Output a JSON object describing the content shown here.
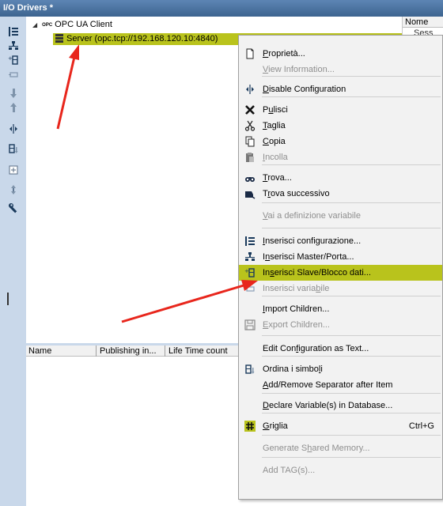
{
  "window": {
    "title": "I/O Drivers *"
  },
  "tree": {
    "root_label": "OPC UA Client",
    "root_badge": "OPC",
    "server_label": "Server (opc.tcp://192.168.120.10:4840)"
  },
  "right_panel": {
    "header": "Nome",
    "cell": "Sess"
  },
  "bottom_panel": {
    "columns": [
      "Name",
      "Publishing in...",
      "Life Time count"
    ]
  },
  "context_menu": {
    "items": [
      {
        "pre": "",
        "u": "P",
        "post": "roprietà...",
        "icon": "property-page-icon"
      },
      {
        "pre": "",
        "u": "V",
        "post": "iew Information...",
        "disabled": true
      },
      {
        "pre": "",
        "u": "D",
        "post": "isable Configuration",
        "icon": "link-broken-icon"
      },
      {
        "pre": "P",
        "u": "u",
        "post": "lisci",
        "icon": "delete-x-icon"
      },
      {
        "pre": "",
        "u": "T",
        "post": "aglia",
        "icon": "scissors-icon"
      },
      {
        "pre": "",
        "u": "C",
        "post": "opia",
        "icon": "copy-icon"
      },
      {
        "pre": "",
        "u": "I",
        "post": "ncolla",
        "icon": "paste-icon",
        "disabled": true
      },
      {
        "pre": "",
        "u": "T",
        "post": "rova...",
        "icon": "binoculars-icon"
      },
      {
        "pre": "T",
        "u": "r",
        "post": "ova successivo",
        "icon": "find-next-icon"
      },
      {
        "pre": "",
        "u": "V",
        "post": "ai a definizione variabile",
        "disabled": true
      },
      {
        "pre": "",
        "u": "I",
        "post": "nserisci configurazione...",
        "icon": "insert-config-icon"
      },
      {
        "pre": "I",
        "u": "n",
        "post": "serisci Master/Porta...",
        "icon": "insert-master-icon"
      },
      {
        "pre": "In",
        "u": "s",
        "post": "erisci Slave/Blocco dati...",
        "icon": "insert-slave-icon",
        "highlighted": true
      },
      {
        "pre": "Inserisci varia",
        "u": "b",
        "post": "ile",
        "icon": "insert-variable-icon",
        "disabled": true
      },
      {
        "pre": "",
        "u": "I",
        "post": "mport Children...",
        "icon": ""
      },
      {
        "pre": "",
        "u": "E",
        "post": "xport Children...",
        "icon": "save-icon",
        "disabled": true
      },
      {
        "pre": "Edit Con",
        "u": "f",
        "post": "iguration as Text..."
      },
      {
        "pre": "Ordina i simbo",
        "u": "l",
        "post": "i",
        "icon": "sort-symbols-icon"
      },
      {
        "pre": "",
        "u": "A",
        "post": "dd/Remove Separator after Item"
      },
      {
        "pre": "",
        "u": "D",
        "post": "eclare Variable(s) in Database..."
      },
      {
        "pre": "",
        "u": "G",
        "post": "riglia",
        "icon": "grid-icon",
        "shortcut": "Ctrl+G"
      },
      {
        "pre": "Generate S",
        "u": "h",
        "post": "ared Memory...",
        "disabled": true
      },
      {
        "pre": "Add TAG(s)...",
        "u": "",
        "post": "",
        "disabled": true
      }
    ]
  },
  "colors": {
    "highlight": "#b9c31c",
    "sidebar": "#c9d8ea",
    "titlebar": "#4a739f",
    "annotation_arrow": "#e8261c"
  }
}
